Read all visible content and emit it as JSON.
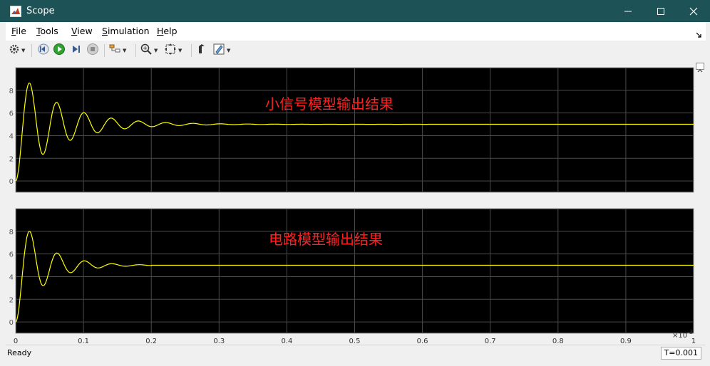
{
  "window": {
    "title": "Scope",
    "controls": {
      "minimize": "—",
      "maximize": "☐",
      "close": "✕"
    }
  },
  "menu": {
    "file": {
      "accel": "F",
      "rest": "ile"
    },
    "tools": {
      "accel": "T",
      "rest": "ools"
    },
    "view": {
      "accel": "V",
      "rest": "iew"
    },
    "simulation": {
      "accel": "S",
      "rest": "imulation"
    },
    "help": {
      "accel": "H",
      "rest": "elp"
    }
  },
  "toolbar": {
    "icons": [
      "gear-icon",
      "step-back-icon",
      "run-icon",
      "step-forward-icon",
      "stop-icon",
      "layout-icon",
      "zoom-in-icon",
      "fit-to-view-icon",
      "cursor-icon",
      "highlight-icon"
    ]
  },
  "scope": {
    "annotation_top": "小信号模型输出结果",
    "annotation_bottom": "电路模型输出结果",
    "x_exponent": "×10",
    "x_exponent_power": "-3",
    "signal_color": "#ffff00",
    "background_color": "#000000"
  },
  "chart_data": [
    {
      "type": "line",
      "title": "",
      "series": [
        {
          "values_x": [
            0,
            0.0001,
            0.0002,
            0.0003,
            0.0004,
            0.0005,
            0.0006,
            0.0007,
            0.0008,
            0.0009,
            0.001
          ],
          "values_y": [
            0,
            5.0,
            5.0,
            5.0,
            5.0,
            5.0,
            5.0,
            5.0,
            5.0,
            5.0,
            5.0
          ],
          "peaks": [
            [
              2e-05,
              8.4
            ],
            [
              4e-05,
              2.7
            ],
            [
              6e-05,
              6.6
            ],
            [
              8e-05,
              4.0
            ],
            [
              0.0001,
              5.7
            ],
            [
              0.00012,
              4.5
            ],
            [
              0.00014,
              5.3
            ],
            [
              0.00016,
              4.75
            ]
          ]
        }
      ],
      "xlim": [
        0,
        0.001
      ],
      "ylim": [
        -1,
        10
      ],
      "yticks": [
        "0",
        "2",
        "4",
        "6",
        "8"
      ],
      "grid": true
    },
    {
      "type": "line",
      "title": "",
      "series": [
        {
          "values_x": [
            0,
            0.0001,
            0.0002,
            0.0003,
            0.0004,
            0.0005,
            0.0006,
            0.0007,
            0.0008,
            0.0009,
            0.001
          ],
          "values_y": [
            0,
            5.0,
            5.0,
            5.0,
            5.0,
            5.0,
            5.0,
            5.0,
            5.0,
            5.0,
            5.0
          ],
          "peaks": [
            [
              2e-05,
              8.4
            ],
            [
              4e-05,
              4.2
            ],
            [
              6e-05,
              5.7
            ],
            [
              8e-05,
              4.6
            ],
            [
              0.0001,
              5.3
            ],
            [
              0.00012,
              4.8
            ],
            [
              0.00014,
              5.15
            ]
          ]
        }
      ],
      "xlim": [
        0,
        0.001
      ],
      "ylim": [
        -1,
        10
      ],
      "yticks": [
        "0",
        "2",
        "4",
        "6",
        "8"
      ],
      "xticks": [
        "0",
        "0.1",
        "0.2",
        "0.3",
        "0.4",
        "0.5",
        "0.6",
        "0.7",
        "0.8",
        "0.9",
        "1"
      ],
      "grid": true
    }
  ],
  "status": {
    "ready": "Ready",
    "time": "T=0.001"
  }
}
